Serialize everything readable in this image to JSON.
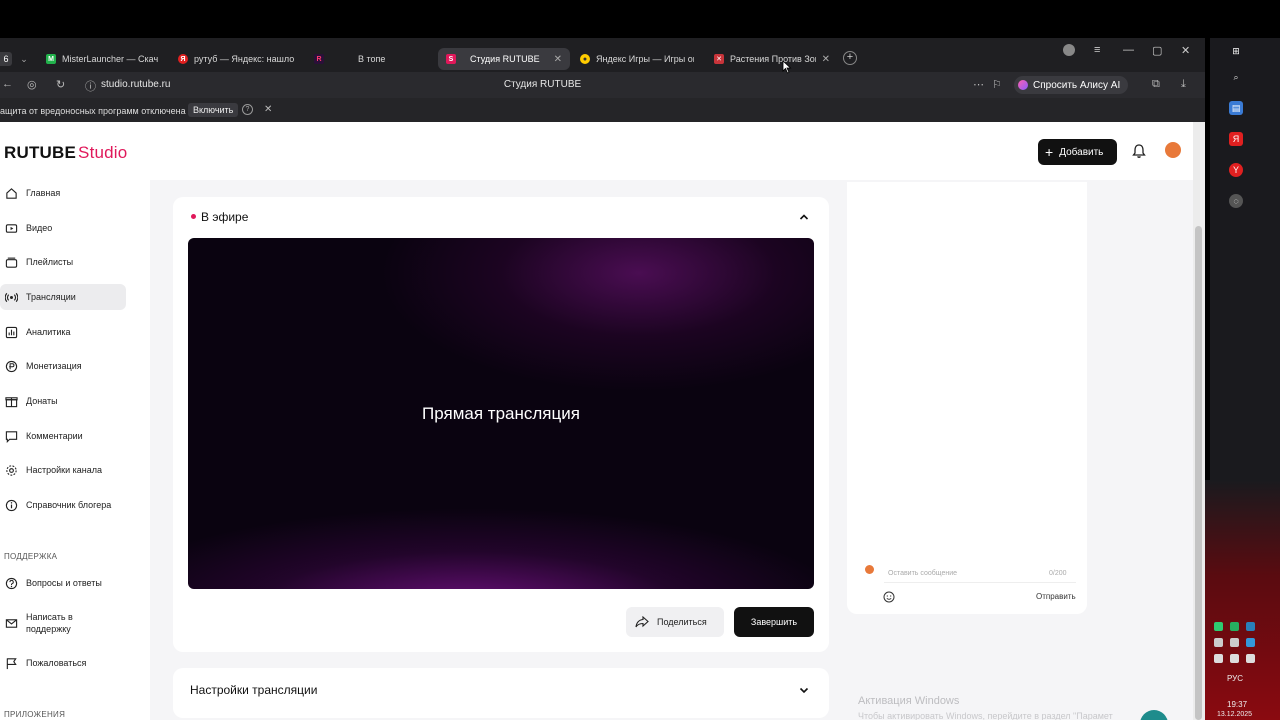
{
  "browser": {
    "tab_counter": "6",
    "tabs": [
      {
        "label": "MisterLauncher — Скачать",
        "icon": "m-green-icon",
        "active": false
      },
      {
        "label": "рутуб — Яндекс: нашлось",
        "icon": "yandex-icon",
        "active": false
      },
      {
        "label": "В топе",
        "icon": "rutube-icon",
        "active": false
      },
      {
        "label": "Студия RUTUBE",
        "icon": "studio-icon",
        "active": true
      },
      {
        "label": "Яндекс Игры — Игры онл",
        "icon": "games-icon",
        "active": false
      },
      {
        "label": "Растения Против Зомб",
        "icon": "pvz-icon",
        "active": false
      }
    ],
    "url": "studio.rutube.ru",
    "page_title": "Студия RUTUBE",
    "alice_label": "Спросить Алису AI",
    "protection_text": "ащита от вредоносных программ отключена",
    "protection_button": "Включить"
  },
  "header": {
    "logo_main": "RUTUBE",
    "logo_sub": "Studio",
    "add_label": "Добавить"
  },
  "sidebar": {
    "items": [
      {
        "label": "Главная",
        "icon": "home-icon"
      },
      {
        "label": "Видео",
        "icon": "video-icon"
      },
      {
        "label": "Плейлисты",
        "icon": "playlist-icon"
      },
      {
        "label": "Трансляции",
        "icon": "broadcast-icon",
        "active": true
      },
      {
        "label": "Аналитика",
        "icon": "analytics-icon"
      },
      {
        "label": "Монетизация",
        "icon": "ruble-icon"
      },
      {
        "label": "Донаты",
        "icon": "donate-icon"
      },
      {
        "label": "Комментарии",
        "icon": "comment-icon"
      },
      {
        "label": "Настройки канала",
        "icon": "gear-icon"
      },
      {
        "label": "Справочник блогера",
        "icon": "info-icon"
      }
    ],
    "support_title": "ПОДДЕРЖКА",
    "support_items": [
      {
        "label": "Вопросы и ответы",
        "icon": "question-icon"
      },
      {
        "label": "Написать в поддержку",
        "label_line1": "Написать в",
        "label_line2": "поддержку",
        "icon": "mail-icon"
      },
      {
        "label": "Пожаловаться",
        "icon": "flag-icon"
      }
    ],
    "apps_title": "ПРИЛОЖЕНИЯ"
  },
  "live": {
    "status": "В эфире",
    "player_title": "Прямая трансляция",
    "share_label": "Поделиться",
    "finish_label": "Завершить",
    "settings_title": "Настройки трансляции"
  },
  "chat": {
    "placeholder": "Оставить сообщение",
    "counter": "0/200",
    "send_label": "Отправить"
  },
  "system": {
    "watermark_title": "Активация Windows",
    "watermark_text": "Чтобы активировать Windows, перейдите в раздел \"Парамет",
    "lang": "РУС",
    "time": "19:37",
    "date": "13.12.2025"
  },
  "colors": {
    "brand": "#e0185a",
    "dark": "#111111",
    "player_bg": "#0a0310"
  }
}
